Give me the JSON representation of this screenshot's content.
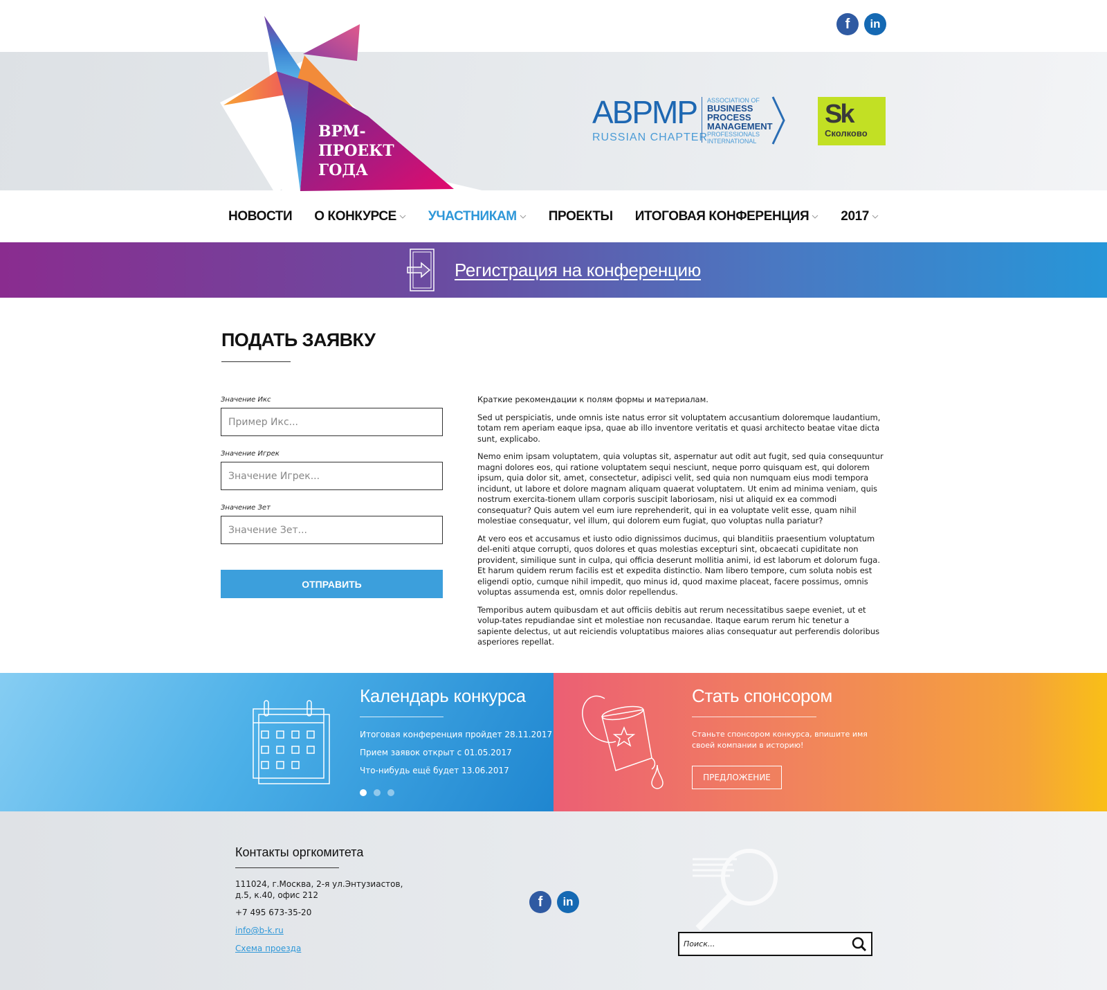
{
  "header": {
    "logo_text": [
      "BPM-",
      "ПРОЕКТ",
      "ГОДА"
    ],
    "partner_abpmp": {
      "name": "ABPMP",
      "chapter": "RUSSIAN CHAPTER",
      "assoc_lines": [
        "ASSOCIATION OF",
        "BUSINESS",
        "PROCESS",
        "MANAGEMENT",
        "PROFESSIONALS",
        "INTERNATIONAL"
      ]
    },
    "partner_sk": {
      "mark": "Sk",
      "name": "Сколково"
    },
    "social": {
      "facebook": "f",
      "linkedin": "in"
    }
  },
  "nav": {
    "items": [
      {
        "label": "НОВОСТИ",
        "dropdown": false
      },
      {
        "label": "О КОНКУРСЕ",
        "dropdown": true
      },
      {
        "label": "УЧАСТНИКАМ",
        "dropdown": true,
        "active": true
      },
      {
        "label": "ПРОЕКТЫ",
        "dropdown": false
      },
      {
        "label": "ИТОГОВАЯ КОНФЕРЕНЦИЯ",
        "dropdown": true
      },
      {
        "label": "2017",
        "dropdown": true
      }
    ]
  },
  "registration": {
    "label": "Регистрация на конференцию",
    "icon": "door-icon"
  },
  "main": {
    "title": "ПОДАТЬ ЗАЯВКУ",
    "form": {
      "fields": [
        {
          "label": "Значение Икс",
          "placeholder": "Пример Икс..."
        },
        {
          "label": "Значение Игрек",
          "placeholder": "Значение Игрек..."
        },
        {
          "label": "Значение Зет",
          "placeholder": "Значение Зет..."
        }
      ],
      "submit_label": "ОТПРАВИТЬ"
    },
    "text": {
      "intro": "Краткие рекомендации к полям формы и материалам.",
      "paragraphs": [
        "Sed ut perspiciatis, unde omnis iste natus error sit voluptatem accusantium doloremque laudantium, totam rem aperiam eaque ipsa, quae ab illo inventore veritatis et quasi architecto beatae vitae dicta sunt, explicabo.",
        "Nemo enim ipsam voluptatem, quia voluptas sit, aspernatur aut odit aut fugit, sed quia consequuntur magni dolores eos, qui ratione voluptatem sequi nesciunt, neque porro quisquam est, qui dolorem ipsum, quia dolor sit, amet, consectetur, adipisci velit, sed quia non numquam eius modi tempora incidunt, ut labore et dolore magnam aliquam quaerat voluptatem. Ut enim ad minima veniam, quis nostrum exercita-tionem ullam corporis suscipit laboriosam, nisi ut aliquid ex ea commodi consequatur? Quis autem vel eum iure reprehenderit, qui in ea voluptate velit esse, quam nihil molestiae consequatur, vel illum, qui dolorem eum fugiat, quo voluptas nulla pariatur?",
        "At vero eos et accusamus et iusto odio dignissimos ducimus, qui blanditiis praesentium voluptatum del-eniti atque corrupti, quos dolores et quas molestias excepturi sint, obcaecati cupiditate non provident, similique sunt in culpa, qui officia deserunt mollitia animi, id est laborum et dolorum fuga. Et harum quidem rerum facilis est et expedita distinctio. Nam libero tempore, cum soluta nobis est eligendi optio, cumque nihil impedit, quo minus id, quod maxime placeat, facere possimus, omnis voluptas assumenda est, omnis dolor repellendus.",
        "Temporibus autem quibusdam et aut officiis debitis aut rerum necessitatibus saepe eveniet, ut et volup-tates repudiandae sint et molestiae non recusandae. Itaque earum rerum hic tenetur a sapiente delectus, ut aut reiciendis voluptatibus maiores alias consequatur aut perferendis doloribus asperiores repellat."
      ]
    }
  },
  "calendar": {
    "title": "Календарь конкурса",
    "lines": [
      "Итоговая конференция пройдет 28.11.2017",
      "Прием заявок открыт с 01.05.2017",
      "Что-нибудь ещё будет 13.06.2017"
    ],
    "slide_count": 3,
    "active_slide": 1,
    "icon": "calendar-icon"
  },
  "sponsor": {
    "title": "Стать спонсором",
    "text": [
      "Станьте спонсором конкурса, впишите имя",
      "своей компании в историю!"
    ],
    "button_label": "ПРЕДЛОЖЕНИЕ",
    "icon": "paint-bucket-icon"
  },
  "footer": {
    "title": "Контакты оргкомитета",
    "address": [
      "111024, г.Москва, 2-я ул.Энтузиастов,",
      "д.5, к.40, офис 212"
    ],
    "phone": "+7 495 673-35-20",
    "email": "info@b-k.ru",
    "map_link": "Схема проезда",
    "search_placeholder": "Поиск..."
  },
  "colors": {
    "accent": "#2e97d8",
    "banner_start": "#8a2c8f",
    "banner_end": "#2796d8",
    "calendar_end": "#1f86d0",
    "sponsor_start": "#ec5f74",
    "sponsor_end": "#f9bf17"
  }
}
